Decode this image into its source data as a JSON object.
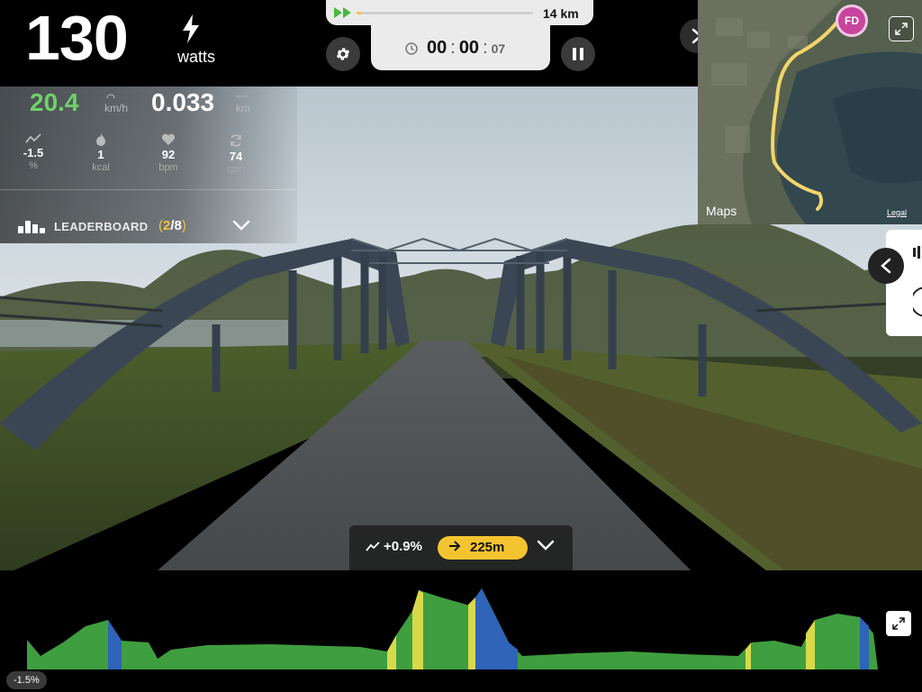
{
  "power": {
    "value": "130",
    "unit": "watts",
    "icon": "lightning-bolt-icon"
  },
  "route": {
    "distance_total": "14 km",
    "progress": 0.03,
    "icon": "fast-forward-icon"
  },
  "timer": {
    "hours": "00",
    "minutes": "00",
    "seconds": "07",
    "icon": "clock-icon"
  },
  "controls": {
    "settings_icon": "gear-icon",
    "pause_icon": "pause-icon",
    "next_icon": "chevron-right-icon"
  },
  "stats": {
    "speed": {
      "value": "20.4",
      "unit": "km/h"
    },
    "distance": {
      "value": "0.033",
      "unit": "km"
    },
    "grade": {
      "value": "-1.5",
      "unit": "%"
    },
    "calories": {
      "value": "1",
      "unit": "kcal"
    },
    "heart_rate": {
      "value": "92",
      "unit": "bpm"
    },
    "cadence": {
      "value": "74",
      "unit": "rpm"
    }
  },
  "leaderboard": {
    "label": "LEADERBOARD",
    "position": "2",
    "total": "8"
  },
  "map": {
    "avatar_initials": "FD",
    "credit": "Maps",
    "legal": "Legal"
  },
  "upcoming": {
    "grade": "+0.9%",
    "distance": "225m"
  },
  "elevation": {
    "current_grade": "-1.5%"
  },
  "colors": {
    "accent_yellow": "#f4c430",
    "speed_green": "#6fd16a",
    "profile_green": "#3f9e3f",
    "profile_yellow": "#d7d94a",
    "profile_blue": "#2f64b8"
  }
}
